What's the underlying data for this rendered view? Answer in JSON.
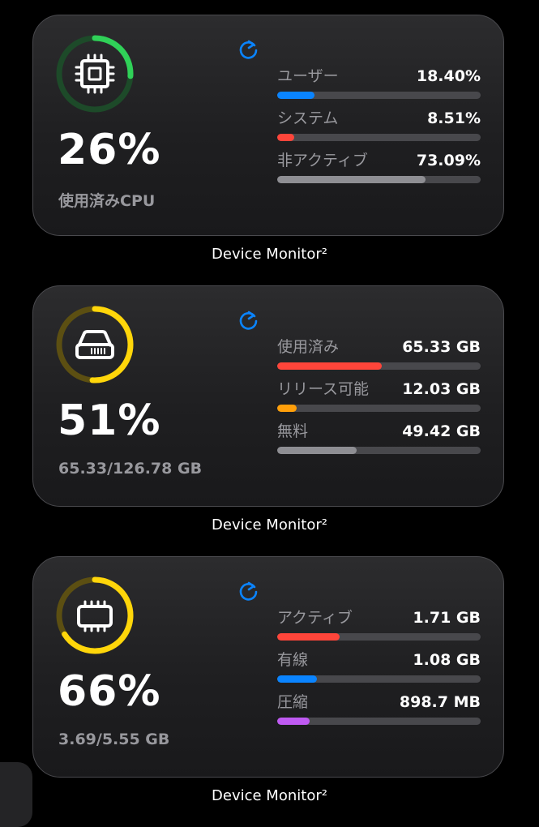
{
  "widgets": [
    {
      "percent": "26%",
      "subtitle": "使用済みCPU",
      "ring_fraction": 0.26,
      "ring_color": "#30d158",
      "ring_track_color": "#1d4a29",
      "icon": "cpu-chip-icon",
      "stats": [
        {
          "label": "ユーザー",
          "value": "18.40%",
          "fraction": 0.184,
          "color": "#0a84ff"
        },
        {
          "label": "システム",
          "value": "8.51%",
          "fraction": 0.085,
          "color": "#ff453a"
        },
        {
          "label": "非アクティブ",
          "value": "73.09%",
          "fraction": 0.731,
          "color": "#8e8e93"
        }
      ],
      "caption": "Device Monitor²"
    },
    {
      "percent": "51%",
      "subtitle": "65.33/126.78 GB",
      "ring_fraction": 0.51,
      "ring_color": "#ffd60a",
      "ring_track_color": "#5c4f12",
      "icon": "storage-drive-icon",
      "stats": [
        {
          "label": "使用済み",
          "value": "65.33 GB",
          "fraction": 0.515,
          "color": "#ff453a"
        },
        {
          "label": "リリース可能",
          "value": "12.03 GB",
          "fraction": 0.095,
          "color": "#ff9f0a"
        },
        {
          "label": "無料",
          "value": "49.42 GB",
          "fraction": 0.39,
          "color": "#8e8e93"
        }
      ],
      "caption": "Device Monitor²"
    },
    {
      "percent": "66%",
      "subtitle": "3.69/5.55 GB",
      "ring_fraction": 0.66,
      "ring_color": "#ffd60a",
      "ring_track_color": "#5c4f12",
      "icon": "memory-chip-icon",
      "stats": [
        {
          "label": "アクティブ",
          "value": "1.71 GB",
          "fraction": 0.308,
          "color": "#ff453a"
        },
        {
          "label": "有線",
          "value": "1.08 GB",
          "fraction": 0.195,
          "color": "#0a84ff"
        },
        {
          "label": "圧縮",
          "value": "898.7 MB",
          "fraction": 0.158,
          "color": "#bf5af2"
        }
      ],
      "caption": "Device Monitor²"
    }
  ],
  "refresh_icon": "refresh-icon",
  "refresh_color": "#0a84ff"
}
